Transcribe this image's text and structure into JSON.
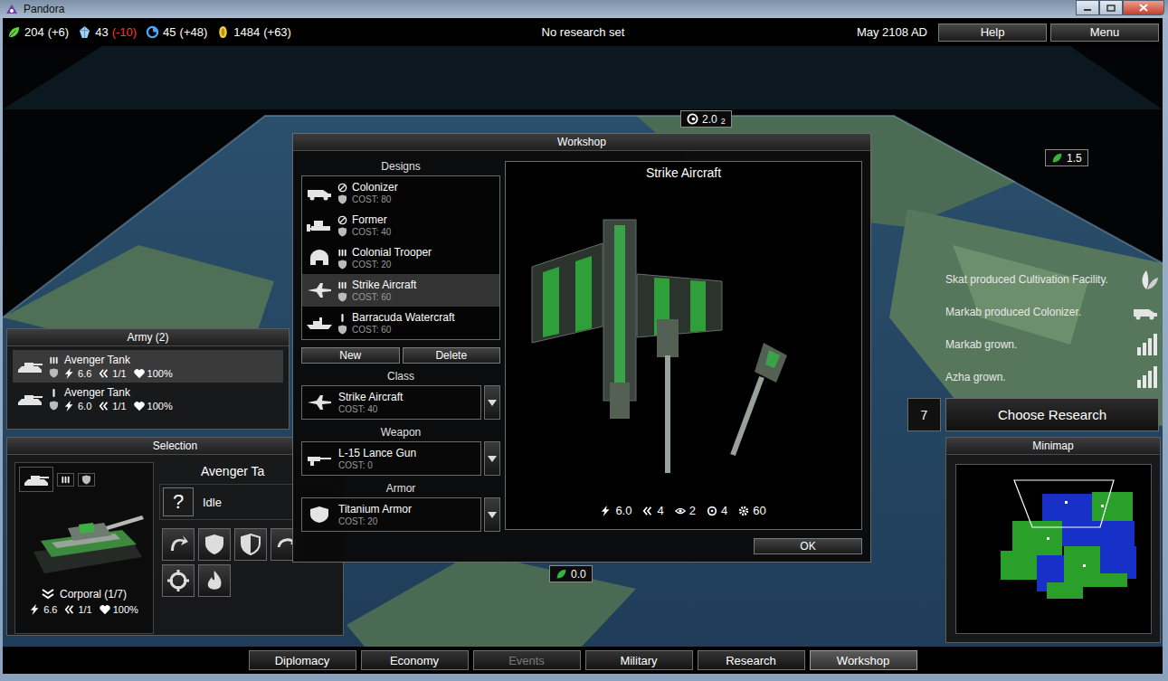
{
  "window": {
    "title": "Pandora"
  },
  "resources": [
    {
      "kind": "food",
      "value": "204",
      "delta": "(+6)",
      "negative": false,
      "color": "#5fd33a"
    },
    {
      "kind": "minerals",
      "value": "43",
      "delta": "(-10)",
      "negative": true,
      "color": "#9fd0f5"
    },
    {
      "kind": "energy",
      "value": "45",
      "delta": "(+48)",
      "negative": false,
      "color": "#4aa8f0"
    },
    {
      "kind": "credits",
      "value": "1484",
      "delta": "(+63)",
      "negative": false,
      "color": "#f2d23a"
    }
  ],
  "research_status": "No research set",
  "date": "May 2108 AD",
  "menu_buttons": [
    {
      "label": "Help"
    },
    {
      "label": "Menu"
    }
  ],
  "map_badges": [
    {
      "kind": "moves",
      "value": "2.0",
      "count": "2"
    },
    {
      "kind": "food",
      "value": "1.5"
    },
    {
      "kind": "food",
      "value": "0.0"
    }
  ],
  "events": [
    {
      "kind": "building",
      "text": "Skat produced Cultivation Facility."
    },
    {
      "kind": "unit",
      "text": "Markab produced Colonizer."
    },
    {
      "kind": "growth",
      "text": "Markab grown."
    },
    {
      "kind": "growth",
      "text": "Azha grown."
    }
  ],
  "research": {
    "queue": "7",
    "label": "Choose Research"
  },
  "minimap": {
    "title": "Minimap"
  },
  "army": {
    "title": "Army (2)",
    "units": [
      {
        "kind": "tank",
        "weapon": "triple",
        "name": "Avenger Tank",
        "attack": "6.6",
        "moves": "1/1",
        "health": "100%",
        "selected": true
      },
      {
        "kind": "tank",
        "weapon": "single",
        "name": "Avenger Tank",
        "attack": "6.0",
        "moves": "1/1",
        "health": "100%",
        "selected": false
      }
    ]
  },
  "selection": {
    "title": "Selection",
    "kind": "tank",
    "weapon": "triple",
    "name": "Avenger Ta",
    "status_icon": "?",
    "status": "Idle",
    "rank": "Corporal (1/7)",
    "attack": "6.6",
    "moves": "1/1",
    "health": "100%"
  },
  "workshop": {
    "title": "Workshop",
    "designs_title": "Designs",
    "designs": [
      {
        "kind": "colonizer",
        "weapon": "none",
        "name": "Colonizer",
        "cost": "COST: 80",
        "selected": false
      },
      {
        "kind": "former",
        "weapon": "none",
        "name": "Former",
        "cost": "COST: 40",
        "selected": false
      },
      {
        "kind": "trooper",
        "weapon": "triple",
        "name": "Colonial Trooper",
        "cost": "COST: 20",
        "selected": false
      },
      {
        "kind": "aircraft",
        "weapon": "triple",
        "name": "Strike Aircraft",
        "cost": "COST: 60",
        "selected": true
      },
      {
        "kind": "watercraft",
        "weapon": "single",
        "name": "Barracuda Watercraft",
        "cost": "COST: 60",
        "selected": false
      }
    ],
    "buttons": [
      {
        "label": "New"
      },
      {
        "label": "Delete"
      }
    ],
    "fields": [
      {
        "label": "Class",
        "kind": "aircraft",
        "value": "Strike Aircraft",
        "cost": "COST: 40"
      },
      {
        "label": "Weapon",
        "kind": "gun",
        "value": "L-15 Lance Gun",
        "cost": "COST: 0"
      },
      {
        "label": "Armor",
        "kind": "armor",
        "value": "Titanium Armor",
        "cost": "COST: 20"
      }
    ],
    "preview": {
      "title": "Strike Aircraft",
      "stats": [
        {
          "kind": "attack",
          "value": "6.0"
        },
        {
          "kind": "moves",
          "value": "4"
        },
        {
          "kind": "sight",
          "value": "2"
        },
        {
          "kind": "range",
          "value": "4"
        },
        {
          "kind": "cost",
          "value": "60"
        }
      ]
    },
    "ok": "OK"
  },
  "tabs": [
    {
      "label": "Diplomacy",
      "selected": false,
      "disabled": false
    },
    {
      "label": "Economy",
      "selected": false,
      "disabled": false
    },
    {
      "label": "Events",
      "selected": false,
      "disabled": true
    },
    {
      "label": "Military",
      "selected": false,
      "disabled": false
    },
    {
      "label": "Research",
      "selected": false,
      "disabled": false
    },
    {
      "label": "Workshop",
      "selected": true,
      "disabled": false
    }
  ]
}
